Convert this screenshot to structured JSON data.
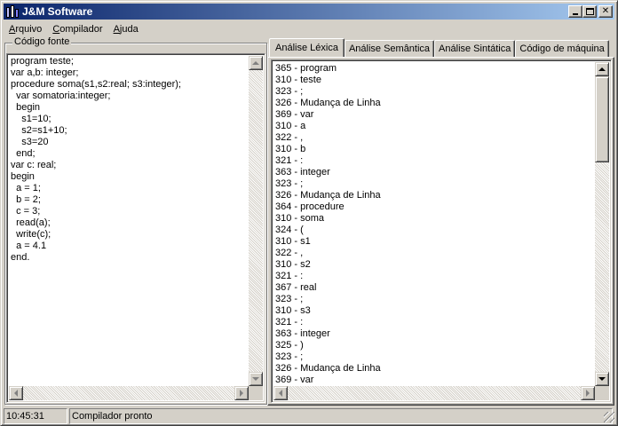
{
  "window": {
    "title": "J&M Software",
    "buttons": [
      "minimize",
      "maximize",
      "close"
    ]
  },
  "menubar": {
    "items": [
      {
        "label": "Arquivo",
        "underline": "A",
        "rest": "rquivo"
      },
      {
        "label": "Compilador",
        "underline": "C",
        "rest": "ompilador"
      },
      {
        "label": "Ajuda",
        "underline": "A",
        "rest": "juda"
      }
    ]
  },
  "source": {
    "group_label": "Código fonte",
    "code": "program teste;\nvar a,b: integer;\nprocedure soma(s1,s2:real; s3:integer);\n  var somatoria:integer;\n  begin\n    s1=10;\n    s2=s1+10;\n    s3=20\n  end;\nvar c: real;\nbegin\n  a = 1;\n  b = 2;\n  c = 3;\n  read(a);\n  write(c);\n  a = 4.1\nend."
  },
  "tabs": [
    {
      "label": "Análise Léxica",
      "active": true
    },
    {
      "label": "Análise Semântica",
      "active": false
    },
    {
      "label": "Análise Sintática",
      "active": false
    },
    {
      "label": "Código de máquina",
      "active": false
    }
  ],
  "lexical": {
    "items": [
      "365 - program",
      "310 - teste",
      "323 - ;",
      "326 - Mudança de Linha",
      "369 - var",
      "310 - a",
      "322 - ,",
      "310 - b",
      "321 - :",
      "363 - integer",
      "323 - ;",
      "326 - Mudança de Linha",
      "364 - procedure",
      "310 - soma",
      "324 - (",
      "310 - s1",
      "322 - ,",
      "310 - s2",
      "321 - :",
      "367 - real",
      "323 - ;",
      "310 - s3",
      "321 - :",
      "363 - integer",
      "325 - )",
      "323 - ;",
      "326 - Mudança de Linha",
      "369 - var"
    ]
  },
  "statusbar": {
    "time": "10:45:31",
    "message": "Compilador pronto"
  },
  "colors": {
    "title_start": "#0a246a",
    "title_end": "#a6caf0",
    "face": "#d4d0c8"
  }
}
